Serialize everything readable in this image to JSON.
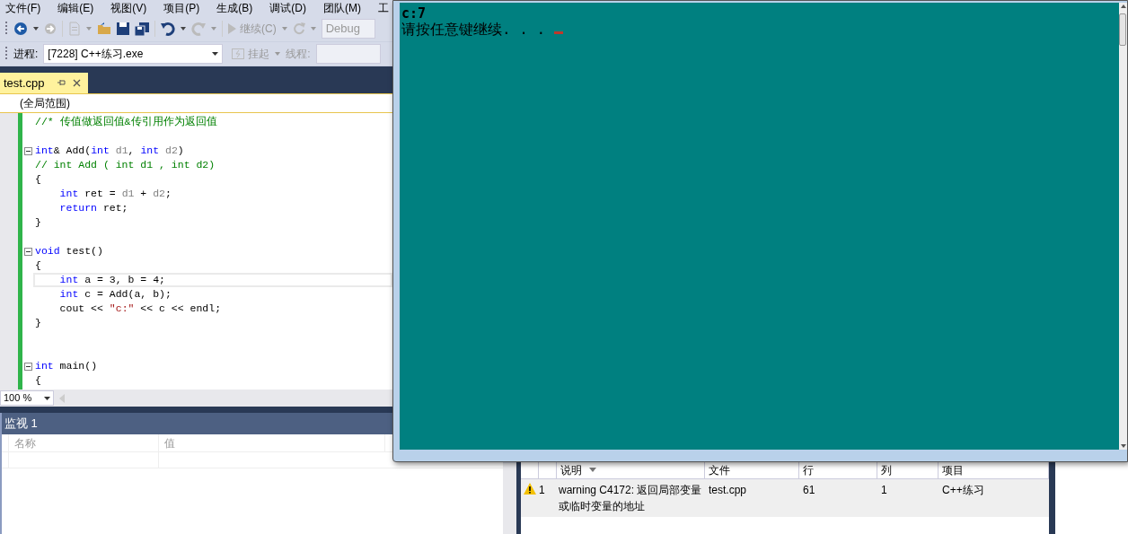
{
  "menu": [
    "文件(F)",
    "编辑(E)",
    "视图(V)",
    "项目(P)",
    "生成(B)",
    "调试(D)",
    "团队(M)",
    "工"
  ],
  "toolbar": {
    "continue": "继续(C)",
    "config": "Debug"
  },
  "process_bar": {
    "label": "进程:",
    "process": "[7228] C++练习.exe",
    "suspend": "挂起",
    "thread_label": "线程:"
  },
  "tabs": [
    {
      "label": "test.cpp",
      "selected": true
    }
  ],
  "scope": "(全局范围)",
  "code": [
    {
      "foldable": false,
      "current": false,
      "tokens": [
        {
          "kind": "comment",
          "text": "//* 传值做返回值&传引用作为返回值"
        }
      ]
    },
    {
      "foldable": false,
      "current": false
    },
    {
      "foldable": true,
      "current": false,
      "tokens": [
        {
          "kind": "keyword",
          "text": "int"
        },
        {
          "kind": "plain",
          "text": "& Add("
        },
        {
          "kind": "keyword",
          "text": "int"
        },
        {
          "kind": "param",
          "text": " d1"
        },
        {
          "kind": "plain",
          "text": ", "
        },
        {
          "kind": "keyword",
          "text": "int"
        },
        {
          "kind": "param",
          "text": " d2"
        },
        {
          "kind": "plain",
          "text": ")"
        }
      ]
    },
    {
      "foldable": false,
      "current": false,
      "tokens": [
        {
          "kind": "comment",
          "text": "// int Add ( int d1 , int d2)"
        }
      ]
    },
    {
      "foldable": false,
      "current": false,
      "tokens": [
        {
          "kind": "plain",
          "text": "{"
        }
      ]
    },
    {
      "foldable": false,
      "current": false,
      "tokens": [
        {
          "kind": "keyword",
          "text": "    int"
        },
        {
          "kind": "plain",
          "text": " ret = "
        },
        {
          "kind": "param",
          "text": "d1"
        },
        {
          "kind": "plain",
          "text": " + "
        },
        {
          "kind": "param",
          "text": "d2"
        },
        {
          "kind": "plain",
          "text": ";"
        }
      ]
    },
    {
      "foldable": false,
      "current": false,
      "tokens": [
        {
          "kind": "keyword",
          "text": "    return"
        },
        {
          "kind": "plain",
          "text": " ret;"
        }
      ]
    },
    {
      "foldable": false,
      "current": false,
      "tokens": [
        {
          "kind": "plain",
          "text": "}"
        }
      ]
    },
    {
      "foldable": false,
      "current": false
    },
    {
      "foldable": true,
      "current": false,
      "tokens": [
        {
          "kind": "keyword",
          "text": "void"
        },
        {
          "kind": "plain",
          "text": " test()"
        }
      ]
    },
    {
      "foldable": false,
      "current": false,
      "tokens": [
        {
          "kind": "plain",
          "text": "{"
        }
      ]
    },
    {
      "foldable": false,
      "current": true,
      "tokens": [
        {
          "kind": "keyword",
          "text": "    int"
        },
        {
          "kind": "plain",
          "text": " a = 3, b = 4;"
        }
      ]
    },
    {
      "foldable": false,
      "current": false,
      "tokens": [
        {
          "kind": "keyword",
          "text": "    int"
        },
        {
          "kind": "plain",
          "text": " c = Add(a, b);"
        }
      ]
    },
    {
      "foldable": false,
      "current": false,
      "tokens": [
        {
          "kind": "plain",
          "text": "    cout << "
        },
        {
          "kind": "string",
          "text": "\"c:\""
        },
        {
          "kind": "plain",
          "text": " << c << endl;"
        }
      ]
    },
    {
      "foldable": false,
      "current": false,
      "tokens": [
        {
          "kind": "plain",
          "text": "}"
        }
      ]
    },
    {
      "foldable": false,
      "current": false
    },
    {
      "foldable": false,
      "current": false
    },
    {
      "foldable": true,
      "current": false,
      "tokens": [
        {
          "kind": "keyword",
          "text": "int"
        },
        {
          "kind": "plain",
          "text": " main()"
        }
      ]
    },
    {
      "foldable": false,
      "current": false,
      "tokens": [
        {
          "kind": "plain",
          "text": "{"
        }
      ]
    }
  ],
  "zoom": "100 %",
  "watch": {
    "title": "监视 1",
    "columns": [
      "名称",
      "值"
    ]
  },
  "error_list": {
    "columns": [
      "说明",
      "文件",
      "行",
      "列",
      "项目"
    ],
    "rows": [
      {
        "kind": "warning",
        "number": "1",
        "description": "warning C4172: 返回局部变量或临时变量的地址",
        "file": "test.cpp",
        "line": "61",
        "column": "1",
        "project": "C++练习"
      }
    ]
  },
  "console": {
    "lines": [
      {
        "kind": "bold",
        "text": "c:7"
      },
      {
        "kind": "plain",
        "text": "请按任意键继续. . ."
      }
    ]
  }
}
